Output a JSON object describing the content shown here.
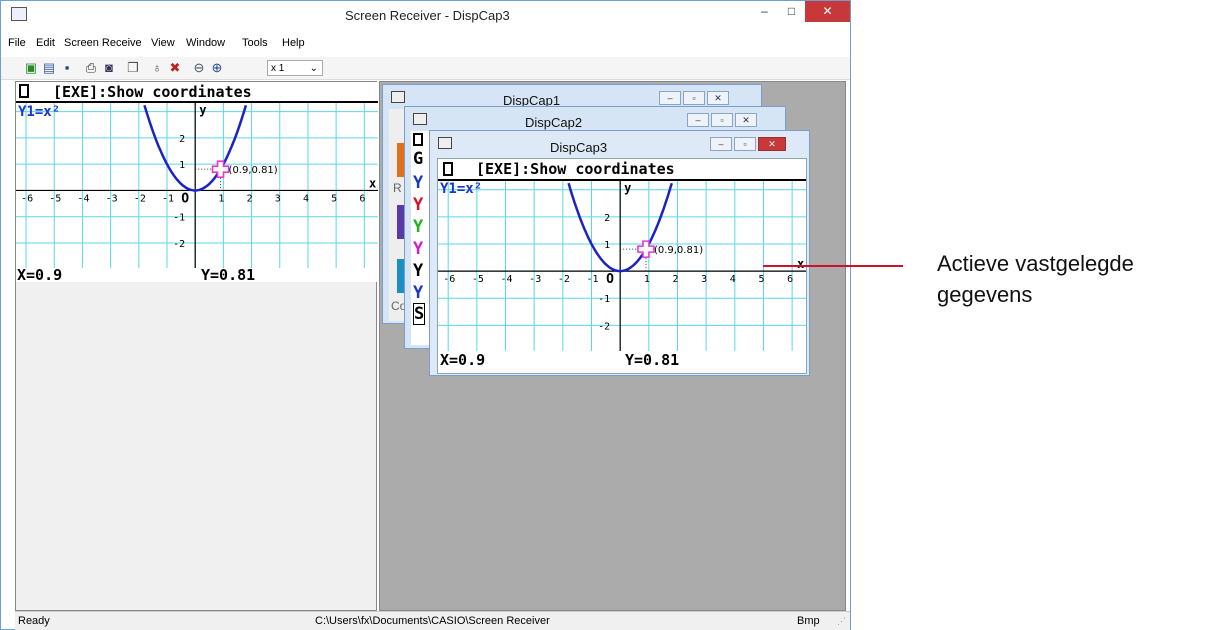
{
  "window": {
    "title": "Screen Receiver - DispCap3",
    "minimize": "–",
    "maximize": "□",
    "close": "✕"
  },
  "menu": [
    "File",
    "Edit",
    "Screen Receive",
    "View",
    "Window",
    "Tools",
    "Help"
  ],
  "toolbar": {
    "zoom_value": "x 1"
  },
  "capture": {
    "header": "[EXE]:Show coordinates",
    "function": "Y1=x²",
    "x_readout": "X=0.9",
    "y_readout": "Y=0.81",
    "point_label": "(0.9,0.81)",
    "axis_x": "x",
    "axis_y": "y",
    "origin": "O",
    "x_ticks": [
      "-6",
      "-5",
      "-4",
      "-3",
      "-2",
      "-1",
      "1",
      "2",
      "3",
      "4",
      "5",
      "6"
    ],
    "y_ticks": [
      "2",
      "1",
      "-1",
      "-2"
    ]
  },
  "sub_windows": {
    "dispcap1": {
      "title": "DispCap1"
    },
    "dispcap2": {
      "title": "DispCap2"
    },
    "dispcap3": {
      "title": "DispCap3"
    },
    "background_glyphs": [
      "G",
      "Y",
      "Y",
      "Y",
      "Y",
      "Y",
      "Y",
      "S"
    ],
    "background_partial": [
      "R",
      "Co"
    ]
  },
  "status": {
    "left": "Ready",
    "path": "C:\\Users\\fx\\Documents\\CASIO\\Screen Receiver",
    "format": "Bmp"
  },
  "callout": {
    "line1": "Actieve vastgelegde",
    "line2": "gegevens"
  },
  "colors": {
    "accent": "#d0102a",
    "grid": "#5ad7e6",
    "curve": "#1a22c8",
    "marker": "#e23ad0"
  }
}
